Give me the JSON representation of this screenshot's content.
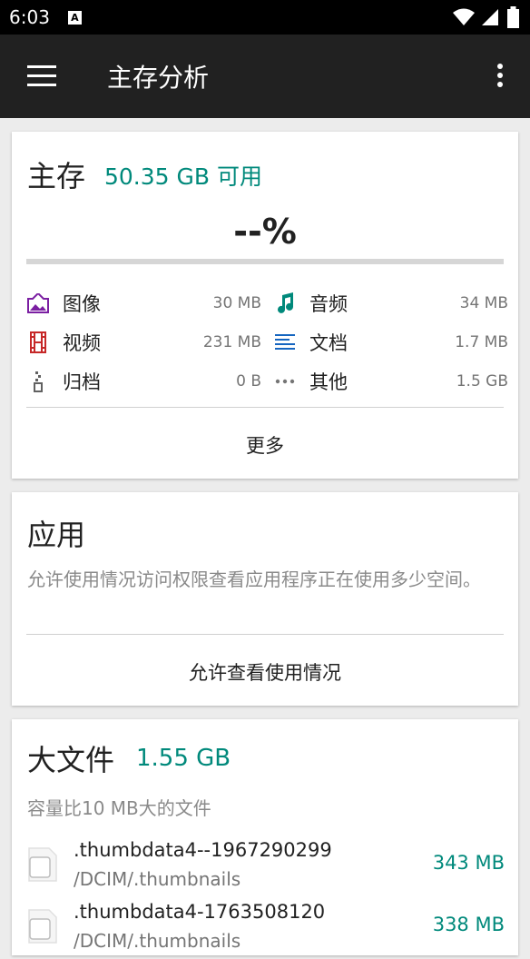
{
  "status": {
    "time": "6:03",
    "notif_glyph": "A"
  },
  "appbar": {
    "title": "主存分析"
  },
  "storage": {
    "title": "主存",
    "free": "50.35 GB 可用",
    "percent": "--%",
    "used_fraction": 0,
    "categories": [
      {
        "label": "图像",
        "size": "30 MB",
        "icon": "image-icon",
        "color": "#7b1fa2"
      },
      {
        "label": "音频",
        "size": "34 MB",
        "icon": "music-note-icon",
        "color": "#00897b"
      },
      {
        "label": "视频",
        "size": "231 MB",
        "icon": "film-icon",
        "color": "#c62828"
      },
      {
        "label": "文档",
        "size": "1.7 MB",
        "icon": "document-lines-icon",
        "color": "#1565c0"
      },
      {
        "label": "归档",
        "size": "0 B",
        "icon": "archive-zipper-icon",
        "color": "#616161"
      },
      {
        "label": "其他",
        "size": "1.5 GB",
        "icon": "more-dots-icon",
        "color": "#757575"
      }
    ],
    "more_label": "更多"
  },
  "apps": {
    "title": "应用",
    "description": "允许使用情况访问权限查看应用程序正在使用多少空间。",
    "action_label": "允许查看使用情况"
  },
  "large_files": {
    "title": "大文件",
    "total": "1.55 GB",
    "description": "容量比10 MB大的文件",
    "files": [
      {
        "name": ".thumbdata4--1967290299",
        "path": "/DCIM/.thumbnails",
        "size": "343 MB"
      },
      {
        "name": ".thumbdata4-1763508120",
        "path": "/DCIM/.thumbnails",
        "size": "338 MB"
      }
    ]
  },
  "colors": {
    "accent": "#00897b",
    "appbar": "#212121",
    "background": "#ececec"
  }
}
